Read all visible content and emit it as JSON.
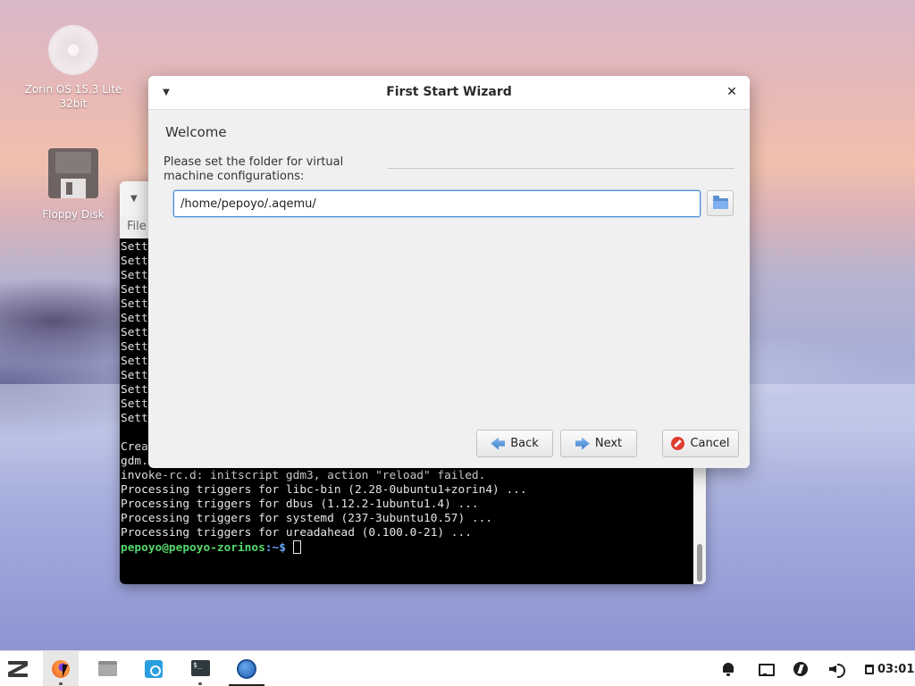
{
  "desktop": {
    "icons": [
      {
        "label": "Zorin OS 15.3 Lite 32bit"
      },
      {
        "label": "Floppy Disk"
      }
    ]
  },
  "terminal": {
    "menu_file": "File",
    "lines": [
      "Sett",
      "Sett",
      "Sett",
      "Sett",
      "Sett",
      "Sett",
      "Sett",
      "Sett",
      "Sett",
      "Sett",
      "Sett",
      "Sett",
      "Sett",
      "",
      "Crea",
      "gdm.",
      "invoke-rc.d: initscript gdm3, action \"reload\" failed.",
      "Processing triggers for libc-bin (2.28-0ubuntu1+zorin4) ...",
      "Processing triggers for dbus (1.12.2-1ubuntu1.4) ...",
      "Processing triggers for systemd (237-3ubuntu10.57) ...",
      "Processing triggers for ureadahead (0.100.0-21) ..."
    ],
    "prompt_user": "pepoyo@pepoyo-zorinos",
    "prompt_path": ":~$ "
  },
  "wizard": {
    "title": "First Start Wizard",
    "heading": "Welcome",
    "prompt": "Please set the folder for virtual machine configurations:",
    "folder_value": "/home/pepoyo/.aqemu/",
    "back_label": "Back",
    "next_label": "Next",
    "cancel_label": "Cancel"
  },
  "taskbar": {
    "clock": "03:01"
  },
  "colors": {
    "accent": "#4a90d9",
    "prompt_user": "#54d86b",
    "prompt_path": "#6aa8ff"
  }
}
